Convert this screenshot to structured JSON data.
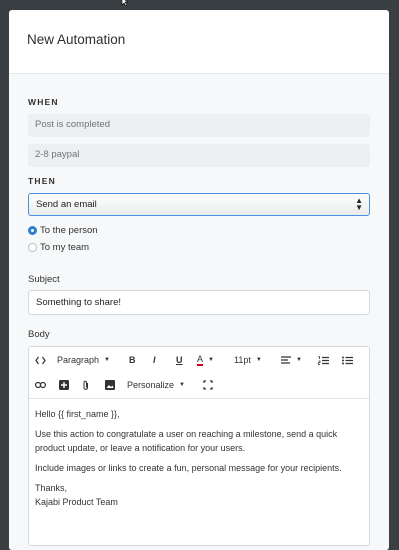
{
  "modal": {
    "title": "New Automation"
  },
  "when": {
    "label": "WHEN",
    "trigger": "Post is completed",
    "target": "2-8 paypal"
  },
  "then": {
    "label": "THEN",
    "action": "Send an email",
    "recipients": [
      {
        "label": "To the person",
        "selected": true
      },
      {
        "label": "To my team",
        "selected": false
      }
    ]
  },
  "subject": {
    "label": "Subject",
    "value": "Something to share!"
  },
  "body": {
    "label": "Body",
    "toolbar": {
      "format": "Paragraph",
      "font_size": "11pt",
      "personalize": "Personalize",
      "bold": "B",
      "italic": "I",
      "underline": "U",
      "font_color": "A"
    },
    "lines": [
      "Hello {{ first_name }},",
      "Use this action to congratulate a user on reaching a milestone, send a quick product update, or leave a notification for your users.",
      "Include images or links to create a fun, personal message for your recipients.",
      "Thanks,",
      "Kajabi Product Team"
    ]
  },
  "colors": {
    "accent": "#2d7dd2",
    "backdrop": "#3a3f44"
  }
}
